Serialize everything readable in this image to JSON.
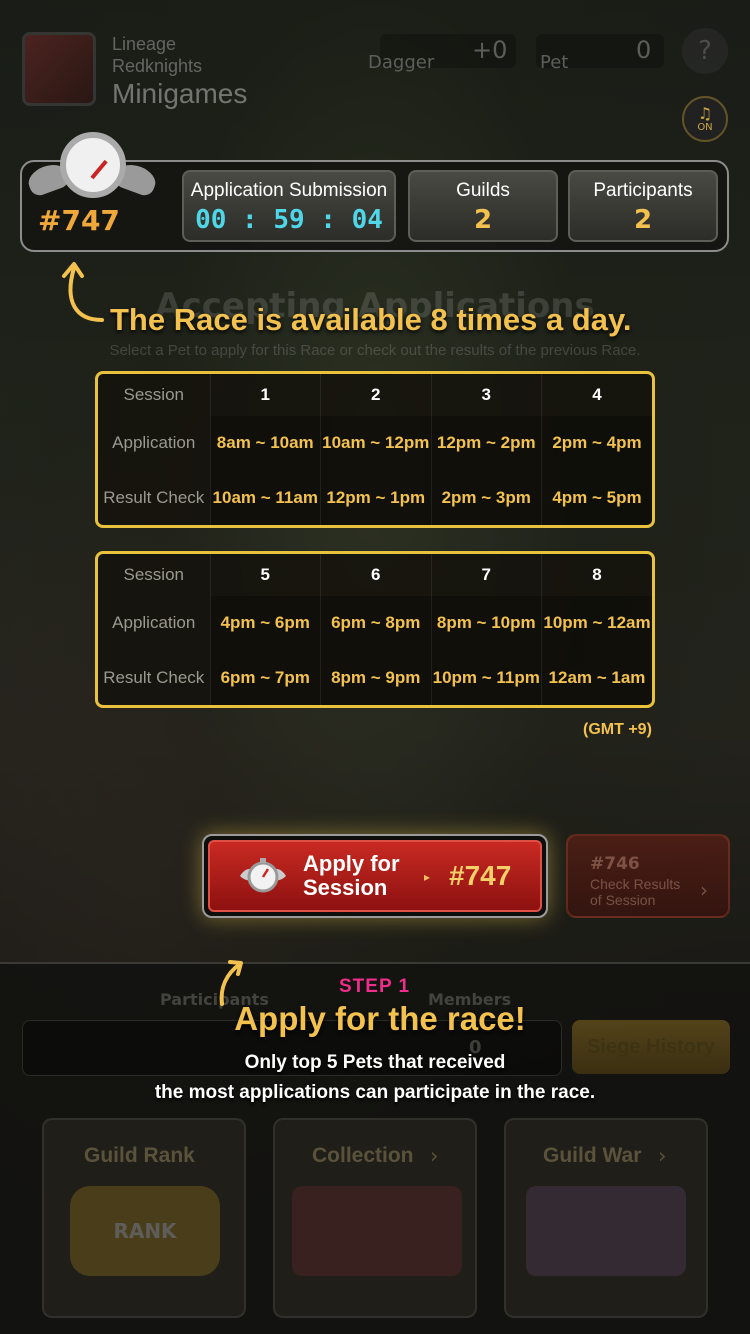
{
  "header": {
    "app_line1": "Lineage",
    "app_line2": "Redknights",
    "app_line3": "Minigames",
    "dagger_label": "Dagger",
    "dagger_value": "+0",
    "pet_label": "Pet",
    "pet_value": "0",
    "help_label": "?",
    "music_label": "ON"
  },
  "race": {
    "number": "#747",
    "application_title": "Application Submission",
    "timer": "00 : 59 : 04",
    "guilds_title": "Guilds",
    "guilds_value": "2",
    "participants_title": "Participants",
    "participants_value": "2"
  },
  "background_text": {
    "title": "Accepting Applications",
    "subtitle": "Select a Pet to apply for this Race or check out the results of the previous Race."
  },
  "annotation_top": "The Race is available 8 times a day.",
  "schedule": {
    "row_headers": [
      "Session",
      "Application",
      "Result Check"
    ],
    "tables": [
      {
        "sessions": [
          "1",
          "2",
          "3",
          "4"
        ],
        "application": [
          "8am ~ 10am",
          "10am ~ 12pm",
          "12pm ~ 2pm",
          "2pm ~ 4pm"
        ],
        "result_check": [
          "10am ~ 11am",
          "12pm ~ 1pm",
          "2pm ~ 3pm",
          "4pm ~ 5pm"
        ]
      },
      {
        "sessions": [
          "5",
          "6",
          "7",
          "8"
        ],
        "application": [
          "4pm ~ 6pm",
          "6pm ~ 8pm",
          "8pm ~ 10pm",
          "10pm ~ 12am"
        ],
        "result_check": [
          "6pm ~ 7pm",
          "8pm ~ 9pm",
          "10pm ~ 11pm",
          "12am ~ 1am"
        ]
      }
    ],
    "timezone": "(GMT +9)"
  },
  "apply_button": {
    "label_line1": "Apply for",
    "label_line2": "Session",
    "session_number": "#747"
  },
  "previous_button": {
    "number": "#746",
    "line1": "Check Results",
    "line2": "of Session"
  },
  "bottom": {
    "participants_label": "Participants",
    "members_label": "Members",
    "count_value": "0",
    "siege_history": "Siege History",
    "cards": [
      "Guild Rank",
      "Collection",
      "Guild War"
    ],
    "rank_badge": "RANK"
  },
  "step": {
    "label": "STEP 1",
    "title": "Apply for the race!",
    "desc_line1": "Only top 5 Pets that received",
    "desc_line2": "the most applications can participate in the race."
  },
  "colors": {
    "accent_gold": "#f2c14e",
    "timer_cyan": "#4fd6e8",
    "step_pink": "#ef2d8a",
    "button_red": "#c92a22"
  }
}
